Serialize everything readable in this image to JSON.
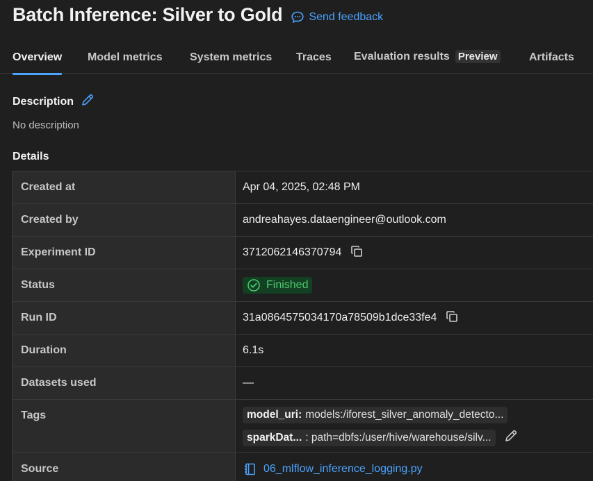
{
  "header": {
    "title": "Batch Inference: Silver to Gold",
    "feedback_label": "Send feedback"
  },
  "tabs": [
    {
      "label": "Overview"
    },
    {
      "label": "Model metrics"
    },
    {
      "label": "System metrics"
    },
    {
      "label": "Traces"
    },
    {
      "label": "Evaluation results",
      "badge": "Preview"
    },
    {
      "label": "Artifacts"
    }
  ],
  "description": {
    "heading": "Description",
    "value": "No description"
  },
  "details": {
    "heading": "Details",
    "created_at": {
      "label": "Created at",
      "value": "Apr 04, 2025, 02:48 PM"
    },
    "created_by": {
      "label": "Created by",
      "value": "andreahayes.dataengineer@outlook.com"
    },
    "experiment_id": {
      "label": "Experiment ID",
      "value": "3712062146370794"
    },
    "status": {
      "label": "Status",
      "value": "Finished"
    },
    "run_id": {
      "label": "Run ID",
      "value": "31a0864575034170a78509b1dce33fe4"
    },
    "duration": {
      "label": "Duration",
      "value": "6.1s"
    },
    "datasets_used": {
      "label": "Datasets used",
      "value": "—"
    },
    "tags": {
      "label": "Tags",
      "items": [
        {
          "key": "model_uri:",
          "value": "models:/iforest_silver_anomaly_detecto..."
        },
        {
          "key": "sparkDat...",
          "value": ": path=dbfs:/user/hive/warehouse/silv..."
        }
      ]
    },
    "source": {
      "label": "Source",
      "value": "06_mlflow_inference_logging.py"
    }
  },
  "colors": {
    "background": "#1f1f1f",
    "accent": "#4aa3ff",
    "status_green": "#4ccb6e"
  }
}
